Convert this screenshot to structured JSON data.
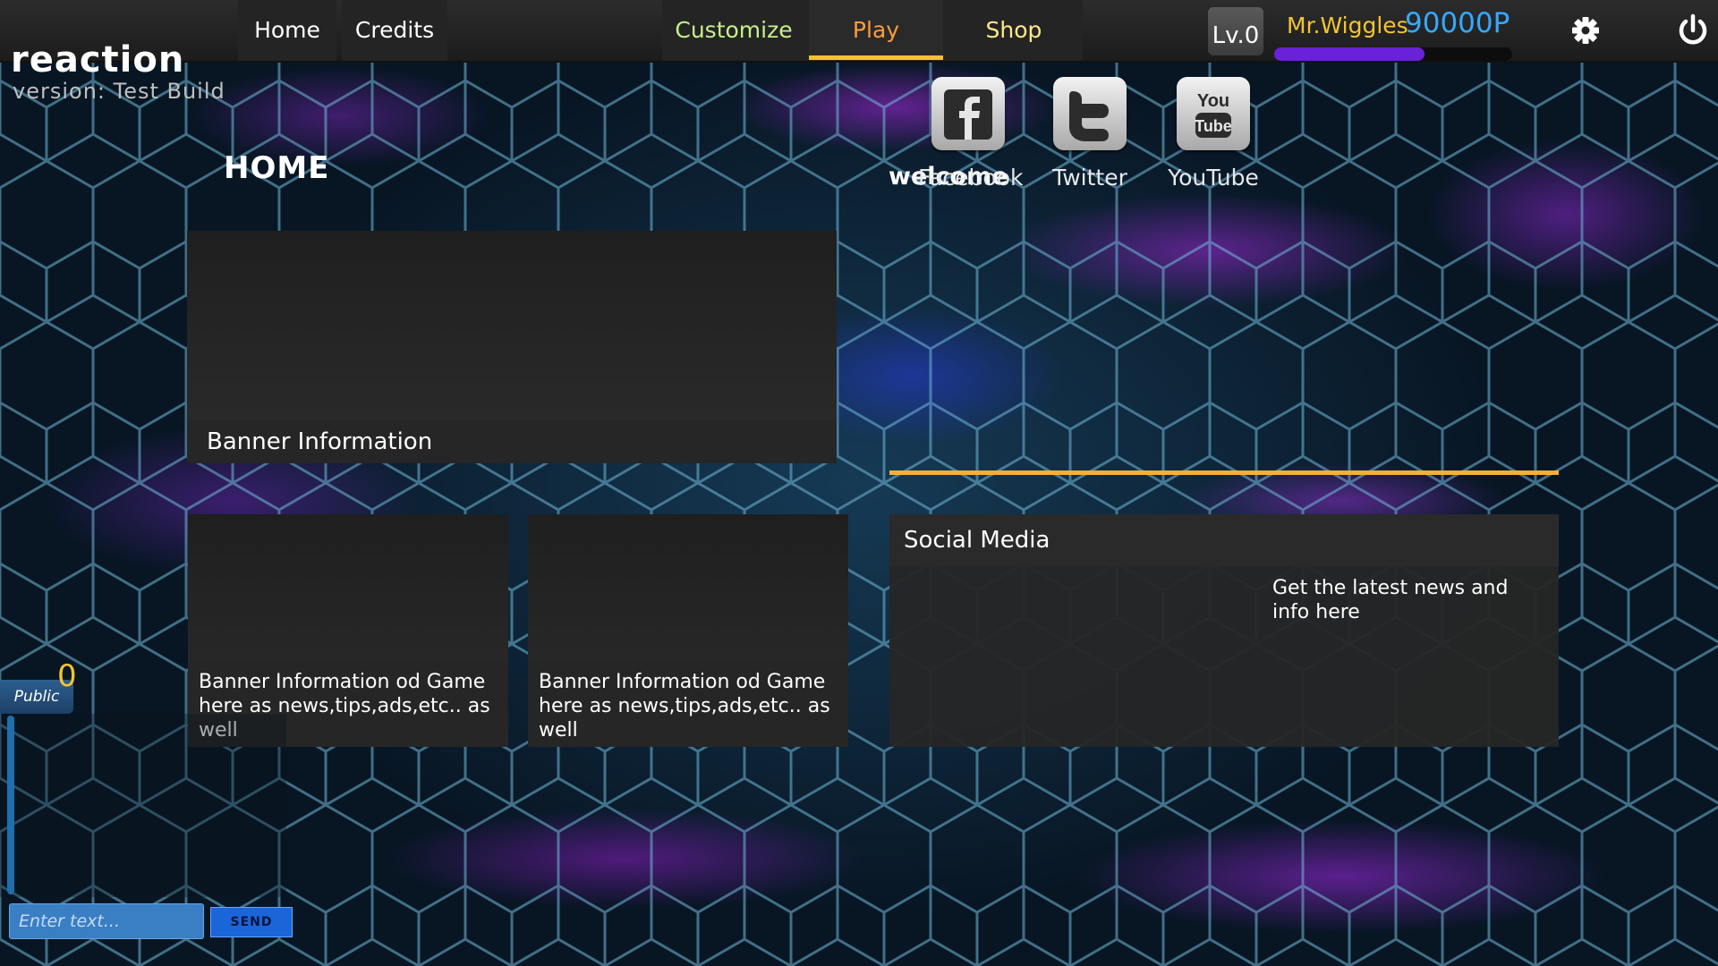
{
  "nav": {
    "home": "Home",
    "credits": "Credits",
    "customize": "Customize",
    "play": "Play",
    "shop": "Shop"
  },
  "player": {
    "level": "Lv.0",
    "name": "Mr.Wiggles",
    "points": "90000P",
    "xp_fraction": 0.63
  },
  "logo": {
    "title": "reaction",
    "version": "version: Test Build"
  },
  "home": {
    "heading": "HOME",
    "main_banner_caption": "Banner Information",
    "banner_a_caption": "Banner Information od Game here as news,tips,ads,etc.. as well",
    "banner_b_caption": "Banner Information od Game here as news,tips,ads,etc.. as well"
  },
  "welcome": {
    "heading": "welcome"
  },
  "social": {
    "title": "Social Media",
    "facebook": "Facebook",
    "twitter": "Twitter",
    "youtube": "YouTube",
    "blurb": "Get the latest news and info here"
  },
  "chat": {
    "channel": "Public",
    "count": "0",
    "placeholder": "Enter text...",
    "send": "SEND"
  },
  "colors": {
    "accent_gold": "#f2c230",
    "points_blue": "#35a9ff",
    "xp_purple": "#6a22d8",
    "customize_green": "#c6f08a",
    "play_orange": "#ff9b3d",
    "shop_yellow": "#ffe88a"
  },
  "icons": {
    "settings": "gear-icon",
    "power": "power-icon",
    "facebook": "facebook-icon",
    "twitter": "twitter-icon",
    "youtube": "youtube-icon"
  }
}
